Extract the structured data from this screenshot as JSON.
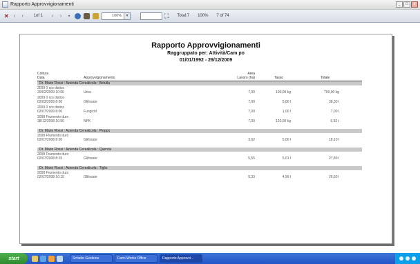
{
  "window": {
    "title": "Rapporto Approvvigionamenti"
  },
  "toolbar": {
    "page_indicator": "1of 1",
    "zoom_value": "100%",
    "total_label": "Total:7",
    "pct_label": "100%",
    "count_label": "7 of 74"
  },
  "report": {
    "title": "Rapporto Approvvigionamenti",
    "subtitle": "Raggruppato per: Attività/Cam po",
    "date_range": "01/01/1992 - 29/12/2009",
    "columns": {
      "coltura": "Coltura",
      "data": "Data",
      "approvvigionamento": "Approvvigionamento",
      "area_1": "Area",
      "area_2": "Lavoro (ha)",
      "tasso": "Tasso",
      "totale": "Totale"
    },
    "groups": [
      {
        "label": "Dr. Mario Rossi : Azienda Cerealicola : Betulla",
        "rows": [
          {
            "coltura": "2009 0 rzo distico",
            "data": "20/02/2009 10:00",
            "approvvigionamento": "Urea",
            "area": "7,00",
            "tasso": "100,00 kg",
            "totale": "700,00 kg"
          },
          {
            "coltura": "2009 0 rzo distico",
            "data": "02/03/2009 8:00",
            "approvvigionamento": "Glifosate",
            "area": "7,00",
            "tasso": "5,00 l",
            "totale": "38,30 l"
          },
          {
            "coltura": "2009 0 rzo distico",
            "data": "02/07/2009 8:00",
            "approvvigionamento": "Fungicid",
            "area": "7,00",
            "tasso": "1,00 l",
            "totale": "7,00 l"
          },
          {
            "coltura": "2008 Frumento duro",
            "data": "28/12/2008 10:50",
            "approvvigionamento": "NPK",
            "area": "7,00",
            "tasso": "120,00 kg",
            "totale": "0,92 t"
          }
        ]
      },
      {
        "label": "Dr. Mario Rossi : Azienda Cerealicola : Pioppo",
        "rows": [
          {
            "coltura": "2008 Frumento duro",
            "data": "02/07/2008 8:00",
            "approvvigionamento": "Glifosate",
            "area": "3,62",
            "tasso": "5,00 l",
            "totale": "18,10 l"
          }
        ]
      },
      {
        "label": "Dr. Mario Rossi : Azienda Cerealicola : Quercia",
        "rows": [
          {
            "coltura": "2008 Frumento duro",
            "data": "02/07/2008 8:15",
            "approvvigionamento": "Glifosate",
            "area": "5,55",
            "tasso": "5,01 l",
            "totale": "27,80 l"
          }
        ]
      },
      {
        "label": "Dr. Mario Rossi : Azienda Cerealicola : Tiglio",
        "rows": [
          {
            "coltura": "2008 Frumento duro",
            "data": "02/07/2008 10:15",
            "approvvigionamento": "Glifosate",
            "area": "5,33",
            "tasso": "4,99 l",
            "totale": "26,60 l"
          }
        ]
      }
    ]
  },
  "taskbar": {
    "start_label": "start",
    "buttons": [
      "Schede Gestione",
      "Farm Works Office",
      "Rapporto Approvvi..."
    ]
  },
  "colors": {
    "group_bar": "#c9c9c9",
    "taskbar": "#2256c8",
    "start": "#2e8a2e"
  },
  "icons": [
    "app-icon",
    "close-icon",
    "first-page-icon",
    "prev-page-icon",
    "next-page-icon",
    "last-page-icon",
    "refresh-icon",
    "print-icon",
    "export-icon",
    "binoculars-icon",
    "minimize-icon",
    "maximize-icon"
  ]
}
